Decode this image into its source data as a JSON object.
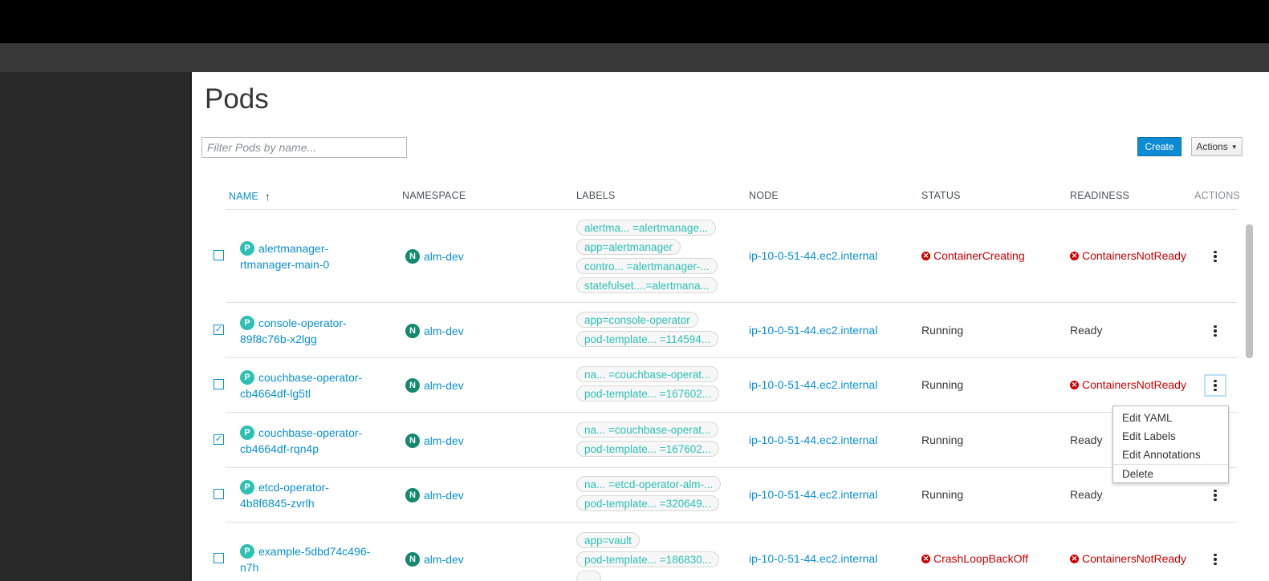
{
  "page": {
    "title": "Pods",
    "filter_placeholder": "Filter Pods by name...",
    "create_label": "Create",
    "actions_label": "Actions"
  },
  "table": {
    "columns": [
      "NAME",
      "NAMESPACE",
      "LABELS",
      "NODE",
      "STATUS",
      "READINESS",
      "ACTIONS"
    ],
    "sort_indicator": "↑",
    "rows": [
      {
        "checked": false,
        "badge": "P",
        "name_line1": "alertmanager-",
        "name_line2": "rtmanager-main-0",
        "ns_badge": "N",
        "namespace": "alm-dev",
        "labels": [
          "alertma... =alertmanage...",
          "app=alertmanager",
          "contro... =alertmanager-...",
          "statefulset....=alertmana..."
        ],
        "node": "ip-10-0-51-44.ec2.internal",
        "status": "ContainerCreating",
        "status_error": true,
        "readiness": "ContainersNotReady",
        "readiness_error": true
      },
      {
        "checked": true,
        "badge": "P",
        "name_line1": "console-operator-",
        "name_line2": "89f8c76b-x2lgg",
        "ns_badge": "N",
        "namespace": "alm-dev",
        "labels": [
          "app=console-operator",
          "pod-template... =114594..."
        ],
        "node": "ip-10-0-51-44.ec2.internal",
        "status": "Running",
        "status_error": false,
        "readiness": "Ready",
        "readiness_error": false
      },
      {
        "checked": false,
        "badge": "P",
        "name_line1": "couchbase-operator-",
        "name_line2": "cb4664df-lg5tl",
        "ns_badge": "N",
        "namespace": "alm-dev",
        "labels": [
          "na...  =couchbase-operat...",
          "pod-template... =167602..."
        ],
        "node": "ip-10-0-51-44.ec2.internal",
        "status": "Running",
        "status_error": false,
        "readiness": "ContainersNotReady",
        "readiness_error": true
      },
      {
        "checked": true,
        "badge": "P",
        "name_line1": "couchbase-operator-",
        "name_line2": "cb4664df-rqn4p",
        "ns_badge": "N",
        "namespace": "alm-dev",
        "labels": [
          "na...  =couchbase-operat...",
          "pod-template... =167602..."
        ],
        "node": "ip-10-0-51-44.ec2.internal",
        "status": "Running",
        "status_error": false,
        "readiness": "Ready",
        "readiness_error": false
      },
      {
        "checked": false,
        "badge": "P",
        "name_line1": "etcd-operator-",
        "name_line2": "4b8f6845-zvrlh",
        "ns_badge": "N",
        "namespace": "alm-dev",
        "labels": [
          "na... =etcd-operator-alm-...",
          "pod-template... =320649..."
        ],
        "node": "ip-10-0-51-44.ec2.internal",
        "status": "Running",
        "status_error": false,
        "readiness": "Ready",
        "readiness_error": false
      },
      {
        "checked": false,
        "badge": "P",
        "name_line1": "example-5dbd74c496-",
        "name_line2": "n7h",
        "ns_badge": "N",
        "namespace": "alm-dev",
        "labels": [
          "app=vault",
          "pod-template... =186830...",
          "..."
        ],
        "node": "ip-10-0-51-44.ec2.internal",
        "status": "CrashLoopBackOff",
        "status_error": true,
        "readiness": "ContainersNotReady",
        "readiness_error": true
      }
    ]
  },
  "row_menu": {
    "items": [
      "Edit YAML",
      "Edit Labels",
      "Edit Annotations",
      "Delete"
    ]
  },
  "colors": {
    "link": "#0a8fd5",
    "error": "#cc0000",
    "primary_button": "#0d8bd4",
    "pod_badge": "#2ec0b3",
    "namespace_badge": "#138a6d"
  }
}
